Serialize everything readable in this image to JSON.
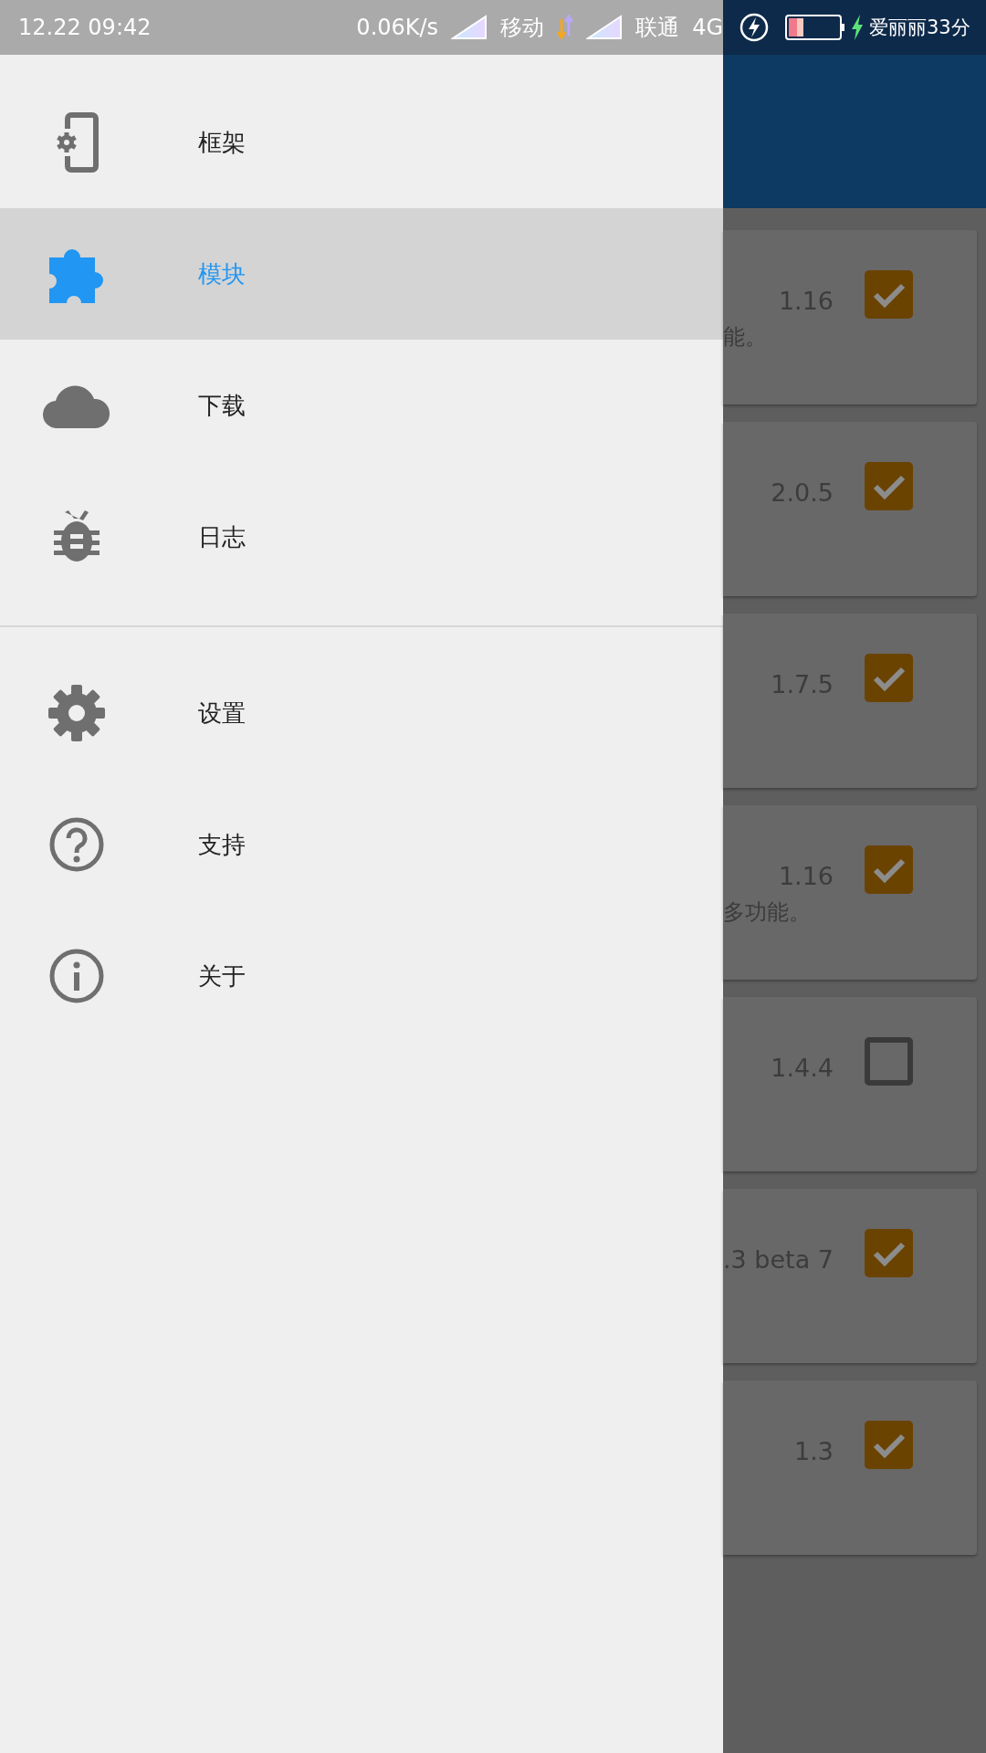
{
  "status_bar": {
    "time": "12.22 09:42",
    "speed": "0.06K/s",
    "carrier_1": "移动",
    "carrier_2": "联通",
    "network": "4G",
    "user": "爱丽丽33分"
  },
  "drawer": {
    "sections": [
      {
        "items": [
          {
            "label": "框架",
            "selected": false
          },
          {
            "label": "模块",
            "selected": true
          },
          {
            "label": "下载",
            "selected": false
          },
          {
            "label": "日志",
            "selected": false
          }
        ]
      },
      {
        "items": [
          {
            "label": "设置",
            "selected": false
          },
          {
            "label": "支持",
            "selected": false
          },
          {
            "label": "关于",
            "selected": false
          }
        ]
      }
    ]
  },
  "modules": [
    {
      "version": "1.16",
      "description": "能。",
      "checked": true
    },
    {
      "version": "2.0.5",
      "checked": true
    },
    {
      "version": "1.7.5",
      "checked": true
    },
    {
      "version": "1.16",
      "description": "多功能。",
      "checked": true
    },
    {
      "version": "1.4.4",
      "checked": false
    },
    {
      "version": ".3 beta 7",
      "checked": true
    },
    {
      "version": "1.3",
      "checked": true
    }
  ]
}
